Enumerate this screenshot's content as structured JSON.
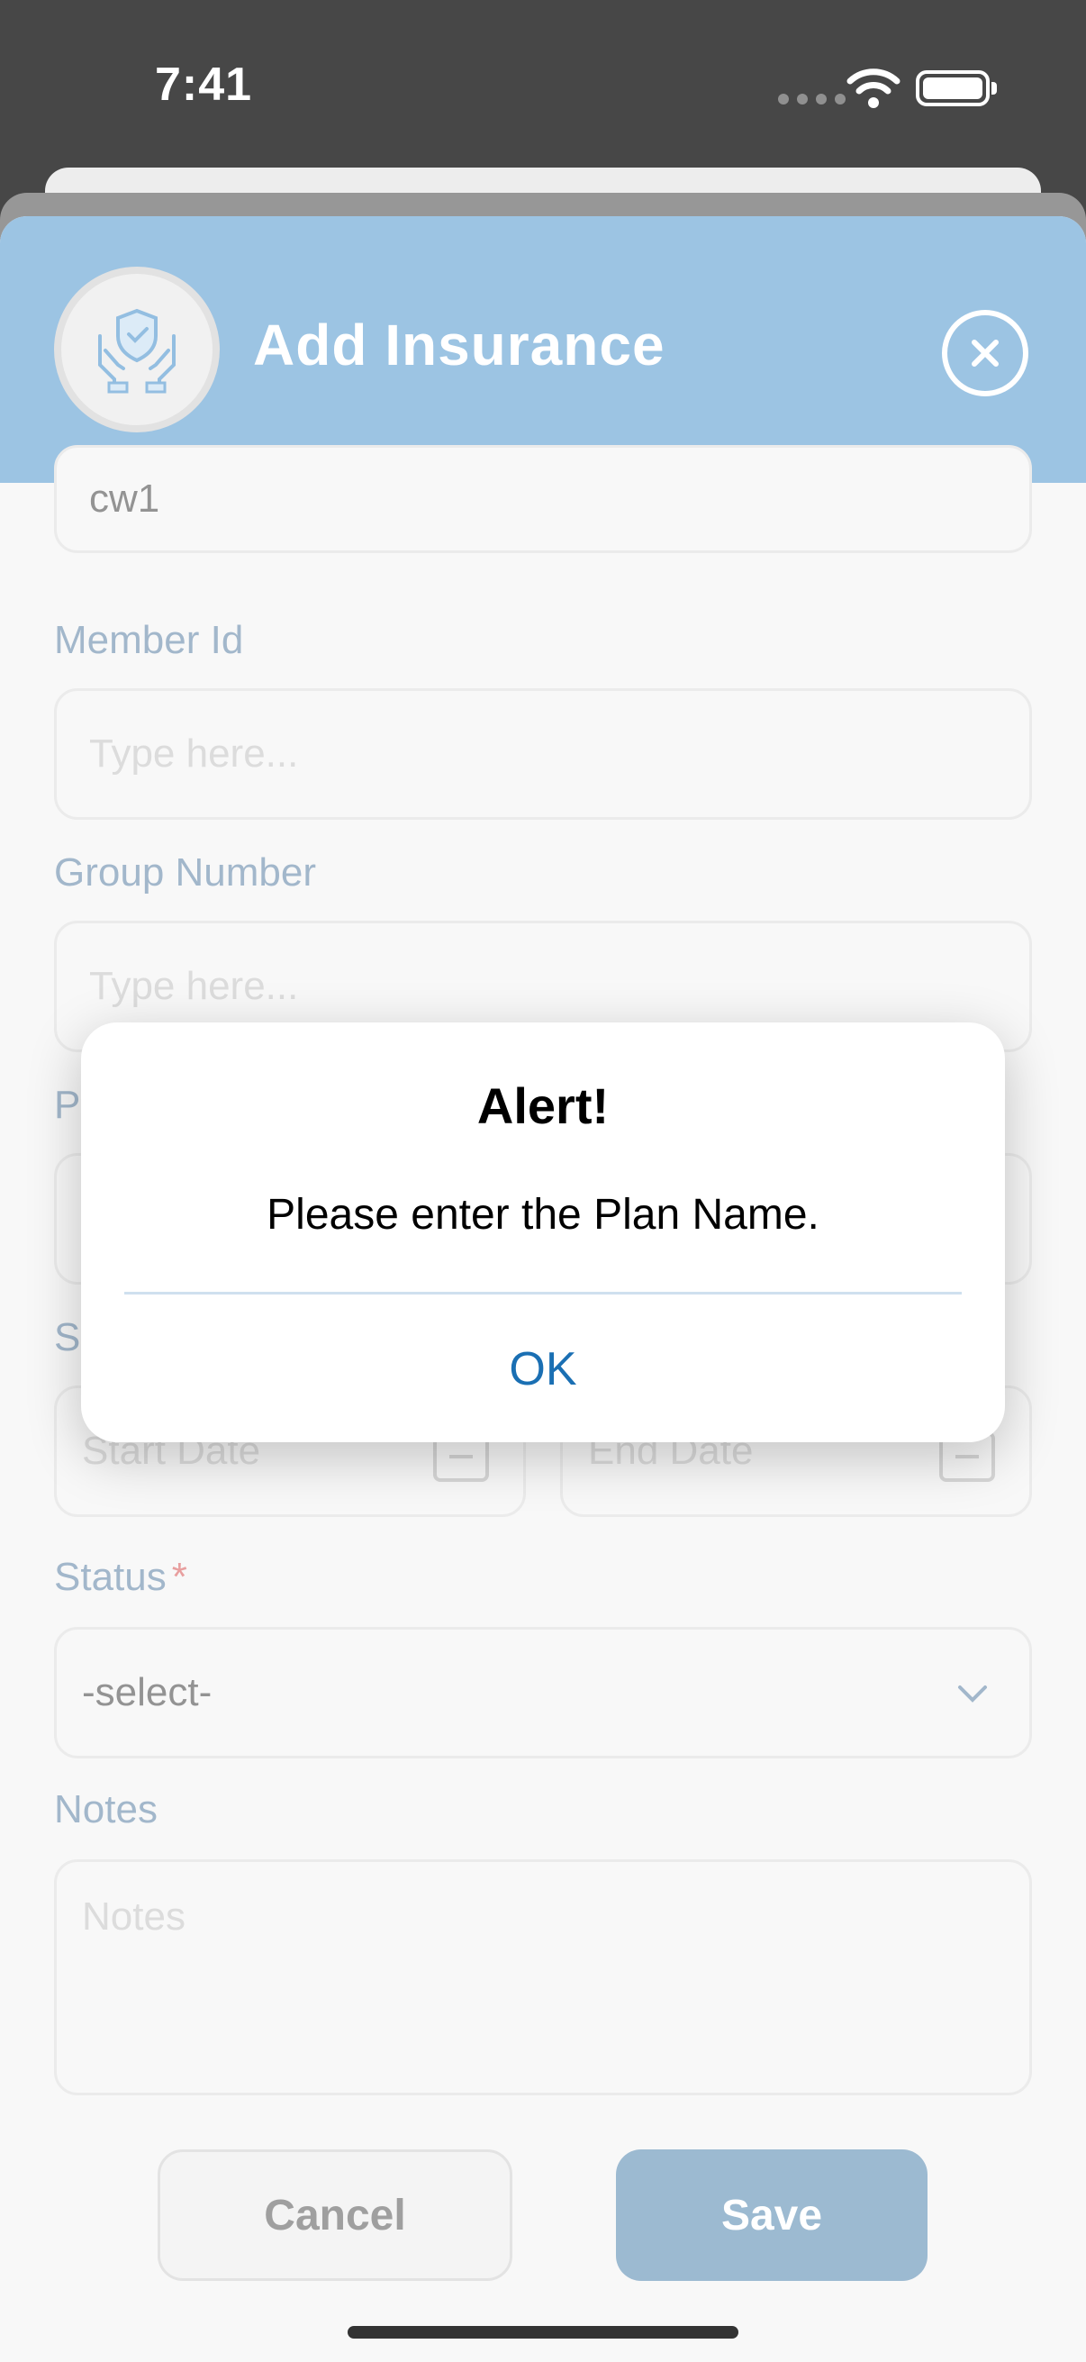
{
  "status_bar": {
    "time": "7:41"
  },
  "header": {
    "title": "Add Insurance"
  },
  "fields": {
    "plan_name_value": "cw1",
    "member_id": {
      "label": "Member Id",
      "placeholder": "Type here..."
    },
    "group_number": {
      "label": "Group Number",
      "placeholder": "Type here..."
    },
    "partial_label_1": "Pl",
    "partial_label_2": "St",
    "start_date": {
      "placeholder": "Start Date"
    },
    "end_date": {
      "placeholder": "End Date"
    },
    "status": {
      "label": "Status",
      "required_mark": "*",
      "value": "-select-"
    },
    "notes": {
      "label": "Notes",
      "placeholder": "Notes"
    }
  },
  "footer": {
    "cancel_label": "Cancel",
    "save_label": "Save"
  },
  "dialog": {
    "title": "Alert!",
    "message": "Please enter the Plan Name.",
    "ok_label": "OK"
  },
  "colors": {
    "header_bg": "#77add9",
    "label": "#7f9cb8",
    "save_bg": "#77a0c0",
    "link": "#1a6fb3"
  }
}
